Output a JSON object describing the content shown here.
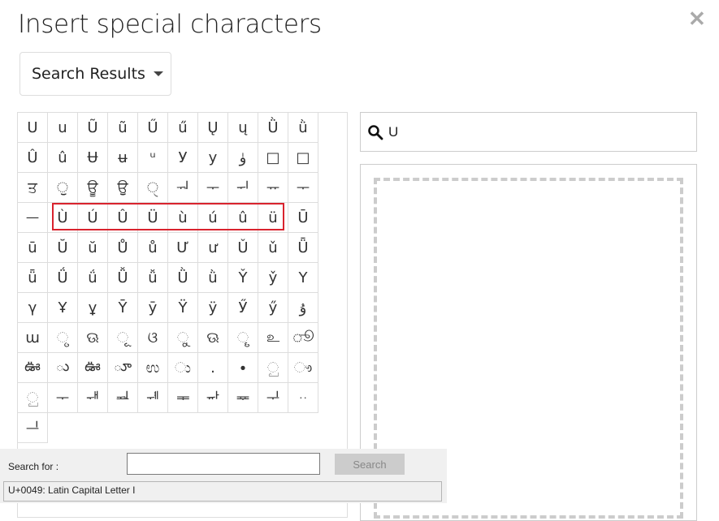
{
  "dialog": {
    "title": "Insert special characters",
    "close_icon": "close-icon"
  },
  "category_dropdown": {
    "selected": "Search Results"
  },
  "search": {
    "value": "U",
    "icon": "search-icon"
  },
  "highlight_color": "#d9232e",
  "chars": [
    "U",
    "u",
    "Ũ",
    "ũ",
    "Ű",
    "ű",
    "Ų",
    "ų",
    "Ǜ",
    "ǜ",
    "Û",
    "û",
    "Ʉ",
    "ʉ",
    "ᵘ",
    "У",
    "у",
    "ۈ",
    "□",
    "□",
    "ਤ",
    "ੁ",
    "ਊ",
    "ਉ",
    "ੑ",
    "ᅯ",
    "ᅮ",
    "ᅱ",
    "ᅲ",
    "ᅮ",
    "ᅳ",
    "Ù",
    "Ú",
    "Û",
    "Ü",
    "ù",
    "ú",
    "û",
    "ü",
    "Ū",
    "ū",
    "Ŭ",
    "ŭ",
    "Ů",
    "ů",
    "Ư",
    "ư",
    "Ǔ",
    "ǔ",
    "Ǖ",
    "ǖ",
    "Ǘ",
    "ǘ",
    "Ǚ",
    "ǚ",
    "Ǜ",
    "ǜ",
    "Y̌",
    "y̌",
    "Y",
    "γ",
    "Ұ",
    "ұ",
    "Ȳ",
    "ȳ",
    "Ÿ",
    "ÿ",
    "Ӳ",
    "ӳ",
    "ۇ",
    "ɯ",
    "ୃ",
    "ଊ",
    "ୂ",
    "ଓ",
    "ୁ",
    "ଊ",
    "ୄ",
    "உ",
    "ூ",
    "ఊ",
    "ు",
    "ఊ",
    "ూ",
    "ಉ",
    "ು",
    ".",
    "∙",
    "ු",
    "ෟ",
    "ු",
    "ᅮ",
    "ᆊ",
    "ᆋ",
    "ᆌ",
    "ᆍ",
    "ᆎ",
    "ᆓ",
    "ᆛ",
    "ᆢ",
    "ᆜ"
  ],
  "overlay": {
    "search_for_label": "Search for :",
    "search_for_value": "",
    "search_button": "Search",
    "status": "U+0049: Latin Capital Letter I"
  }
}
